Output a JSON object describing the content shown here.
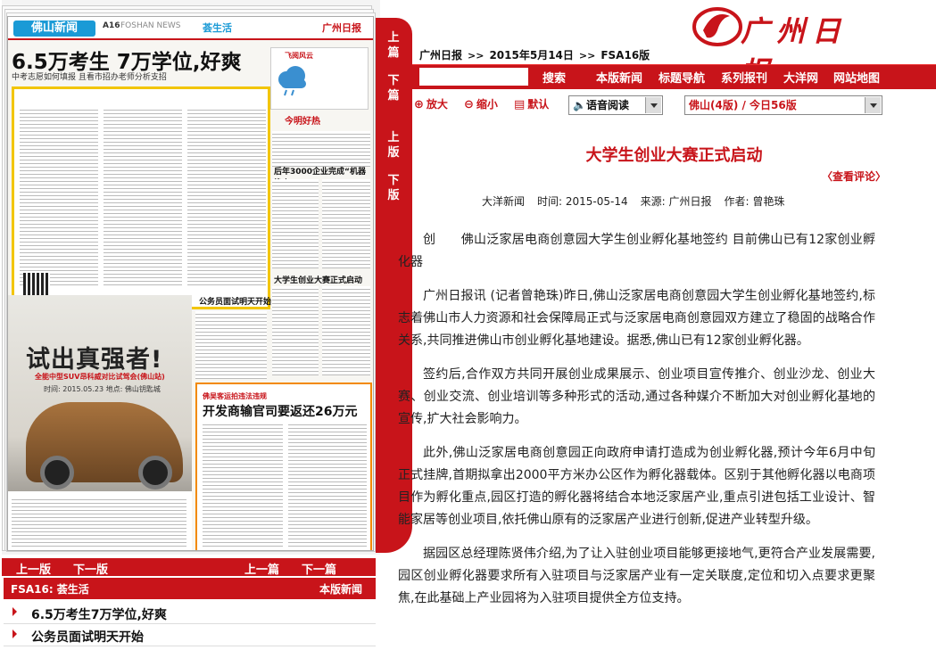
{
  "left_panel": {
    "newspaper": {
      "logo": "佛山新闻",
      "page_no": "A16",
      "page_name": "FOSHAN NEWS",
      "section": "荟生活",
      "paper": "广州日报",
      "headline": "6.5万考生 7万学位,好爽",
      "subheadline": "中考志愿如何填报 且看市招办老师分析支招",
      "weather_label": "飞阅风云",
      "weather_title": "今明好热",
      "story1_title": "后年3000企业完成“机器换人”",
      "story2_title": "大学生创业大赛正式启动",
      "story3_title": "公务员面试明天开始",
      "ad_title": "试出真强者!",
      "ad_sub": "全能中型SUV昂科威对比试驾会(佛山站)",
      "ad_date": "时间: 2015.05.23  地点: 佛山钥匙城",
      "box_head": "佛吴客运拍违法违规",
      "box_title": "开发商输官司要返还26万元"
    },
    "vertical_nav": [
      "上篇",
      "下篇",
      "上版",
      "下版"
    ],
    "bottom_nav": {
      "prev_page": "上一版",
      "next_page": "下一版",
      "prev_article": "上一篇",
      "next_article": "下一篇"
    },
    "section_header": {
      "label": "FSA16: 荟生活",
      "link": "本版新闻"
    },
    "related": [
      "6.5万考生7万学位,好爽",
      "公务员面试明天开始"
    ]
  },
  "header": {
    "logo_text": "广州日报"
  },
  "breadcrumb": {
    "items": [
      "广州日报",
      "2015年5月14日",
      "FSA16版"
    ],
    "separator": ">>"
  },
  "nav": {
    "search_placeholder": "",
    "search_button": "搜索",
    "links": [
      "本版新闻",
      "标题导航",
      "系列报刊",
      "大洋网",
      "网站地图"
    ]
  },
  "toolbar": {
    "zoom_in": "放大",
    "zoom_out": "缩小",
    "default": "默认",
    "voice": "语音阅读",
    "edition_select": "佛山(4版)  /  今日56版"
  },
  "article": {
    "title": "大学生创业大赛正式启动",
    "view_comments": "〈查看评论〉",
    "source_site": "大洋新闻",
    "time_label": "时间:",
    "time": "2015-05-14",
    "origin_label": "来源:",
    "origin": "广州日报",
    "author_label": "作者:",
    "author": "曾艳珠",
    "paragraphs": [
      "创　　佛山泛家居电商创意园大学生创业孵化基地签约 目前佛山已有12家创业孵化器",
      "广州日报讯 (记者曾艳珠)昨日,佛山泛家居电商创意园大学生创业孵化基地签约,标志着佛山市人力资源和社会保障局正式与泛家居电商创意园双方建立了稳固的战略合作关系,共同推进佛山市创业孵化基地建设。据悉,佛山已有12家创业孵化器。",
      "签约后,合作双方共同开展创业成果展示、创业项目宣传推介、创业沙龙、创业大赛、创业交流、创业培训等多种形式的活动,通过各种媒介不断加大对创业孵化基地的宣传,扩大社会影响力。",
      "此外,佛山泛家居电商创意园正向政府申请打造成为创业孵化器,预计今年6月中旬正式挂牌,首期拟拿出2000平方米办公区作为孵化器载体。区别于其他孵化器以电商项目作为孵化重点,园区打造的孵化器将结合本地泛家居产业,重点引进包括工业设计、智能家居等创业项目,依托佛山原有的泛家居产业进行创新,促进产业转型升级。",
      "据园区总经理陈贤伟介绍,为了让入驻创业项目能够更接地气,更符合产业发展需要,园区创业孵化器要求所有入驻项目与泛家居产业有一定关联度,定位和切入点要求更聚焦,在此基础上产业园将为入驻项目提供全方位支持。"
    ]
  },
  "colors": {
    "brand_red": "#c8141a",
    "accent_blue": "#1a9ad6",
    "yellow_frame": "#f2c500"
  }
}
